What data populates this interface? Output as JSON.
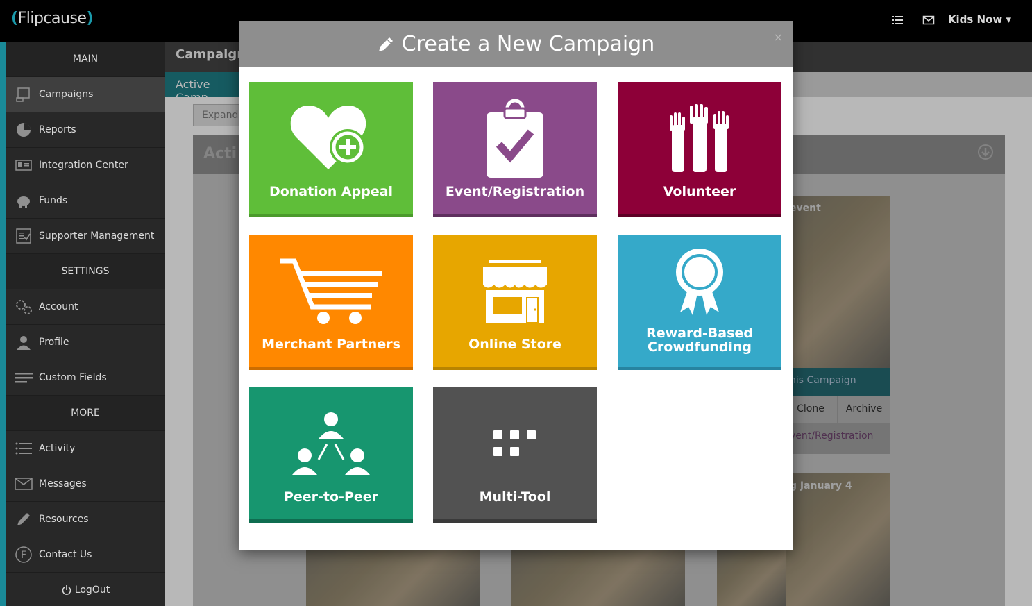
{
  "app": {
    "logo_text": "Flipcause",
    "account_label": "Kids Now"
  },
  "topbar": {
    "icons": [
      "list-icon",
      "envelope-icon"
    ]
  },
  "sidebar": {
    "sections": {
      "main": "MAIN",
      "settings": "SETTINGS",
      "more": "MORE"
    },
    "items": [
      {
        "label": "Campaigns",
        "icon": "campaigns-icon"
      },
      {
        "label": "Reports",
        "icon": "pie-chart-icon"
      },
      {
        "label": "Integration Center",
        "icon": "integration-icon"
      },
      {
        "label": "Funds",
        "icon": "piggy-bank-icon"
      },
      {
        "label": "Supporter Management",
        "icon": "checklist-icon"
      },
      {
        "label": "Account",
        "icon": "gears-icon"
      },
      {
        "label": "Profile",
        "icon": "user-icon"
      },
      {
        "label": "Custom Fields",
        "icon": "lines-icon"
      },
      {
        "label": "Activity",
        "icon": "list-icon"
      },
      {
        "label": "Messages",
        "icon": "envelope-icon"
      },
      {
        "label": "Resources",
        "icon": "pencil-icon"
      },
      {
        "label": "Contact Us",
        "icon": "flipcause-f-icon"
      },
      {
        "label": "LogOut",
        "icon": "power-icon"
      }
    ]
  },
  "background": {
    "header_title": "Campaigns",
    "tab_label": "Active Camp",
    "expand_label": "Expand",
    "panel_title": "Acti",
    "card1": {
      "title_fragment": "event",
      "campaign_fragment": "nis Campaign",
      "clone": "Clone",
      "archive": "Archive",
      "type_fragment": "vent/Registration"
    },
    "card2": {
      "title_fragment": "g January 4"
    }
  },
  "modal": {
    "title": "Create a New Campaign",
    "close": "×",
    "tiles": [
      {
        "label": "Donation Appeal",
        "color": "#5fbe39",
        "shadow": "#4b9a2c",
        "icon": "heart-plus-icon"
      },
      {
        "label": "Event/Registration",
        "color": "#8a4a8a",
        "shadow": "#5e305e",
        "icon": "clipboard-check-icon"
      },
      {
        "label": "Volunteer",
        "color": "#8d0038",
        "shadow": "#5e0025",
        "icon": "raised-hands-icon"
      },
      {
        "label": "Merchant Partners",
        "color": "#ff8800",
        "shadow": "#cc6d00",
        "icon": "shopping-cart-icon"
      },
      {
        "label": "Online Store",
        "color": "#e7a600",
        "shadow": "#b88400",
        "icon": "storefront-icon"
      },
      {
        "label_line1": "Reward-Based",
        "label_line2": "Crowdfunding",
        "color": "#35a9c9",
        "shadow": "#2784a0",
        "icon": "ribbon-award-icon"
      },
      {
        "label": "Peer-to-Peer",
        "color": "#17966f",
        "shadow": "#0f6d50",
        "icon": "people-network-icon"
      },
      {
        "label": "Multi-Tool",
        "color": "#525252",
        "shadow": "#3a3a3a",
        "icon": "grid-dots-icon"
      }
    ]
  }
}
